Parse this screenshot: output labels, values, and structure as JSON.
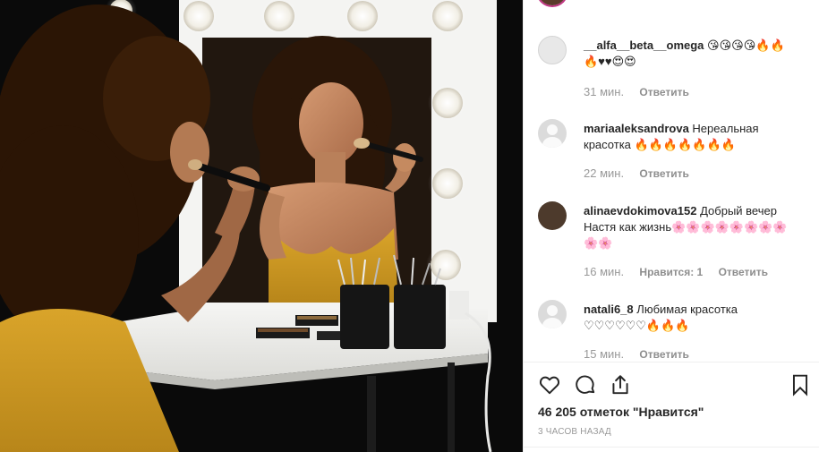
{
  "post": {
    "photo_alt": "",
    "likes_text": "46 205 отметок \"Нравится\"",
    "posted_ago": "3 ЧАСОВ НАЗАД"
  },
  "comments": [
    {
      "username": "__alfa__beta__omega",
      "text": "😘😘😘😘🔥🔥🔥♥♥😍😍",
      "time": "31 мин.",
      "reply_label": "Ответить"
    },
    {
      "username": "mariaaleksandrova",
      "text": "Нереальная красотка 🔥🔥🔥🔥🔥🔥🔥",
      "time": "22 мин.",
      "reply_label": "Ответить"
    },
    {
      "username": "alinaevdokimova152",
      "text": "Добрый вечер Настя как жизнь🌸🌸🌸🌸🌸🌸🌸🌸🌸🌸",
      "time": "16 мин.",
      "likes_label": "Нравится: 1",
      "reply_label": "Ответить"
    },
    {
      "username": "natali6_8",
      "text": "Любимая красотка ♡♡♡♡♡♡🔥🔥🔥",
      "time": "15 мин.",
      "reply_label": "Ответить"
    }
  ],
  "icons": {
    "like": "heart-outline-icon",
    "comment": "speech-bubble-icon",
    "share": "share-upload-icon",
    "save": "bookmark-icon",
    "comment_like": "small-heart-icon"
  }
}
